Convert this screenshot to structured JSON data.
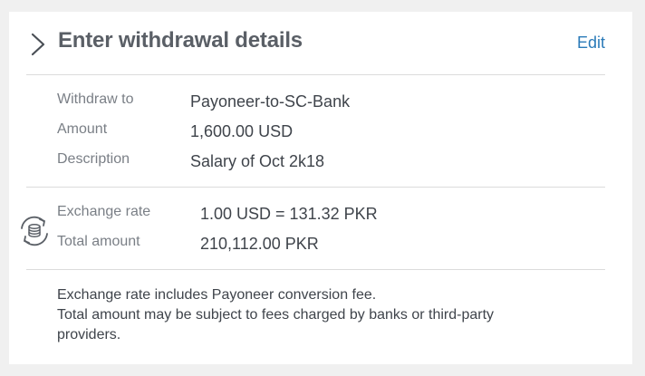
{
  "header": {
    "title": "Enter withdrawal details",
    "edit_label": "Edit"
  },
  "details": [
    {
      "label": "Withdraw to",
      "value": "Payoneer-to-SC-Bank"
    },
    {
      "label": "Amount",
      "value": "1,600.00 USD"
    },
    {
      "label": "Description",
      "value": "Salary of Oct 2k18"
    }
  ],
  "exchange": {
    "rate_label": "Exchange rate",
    "rate_value": "1.00 USD = 131.32 PKR",
    "total_label": "Total amount",
    "total_value": "210,112.00 PKR",
    "icon": "currency-exchange-icon"
  },
  "notes": {
    "line1": "Exchange rate includes Payoneer conversion fee.",
    "line2": "Total amount may be subject to fees charged by banks or third-party providers."
  },
  "colors": {
    "accent": "#2a7ab8",
    "title": "#5a5f66",
    "label": "#7a7f86",
    "value": "#3f444b",
    "divider": "#dcdcdc",
    "background": "#f0f0f0"
  }
}
